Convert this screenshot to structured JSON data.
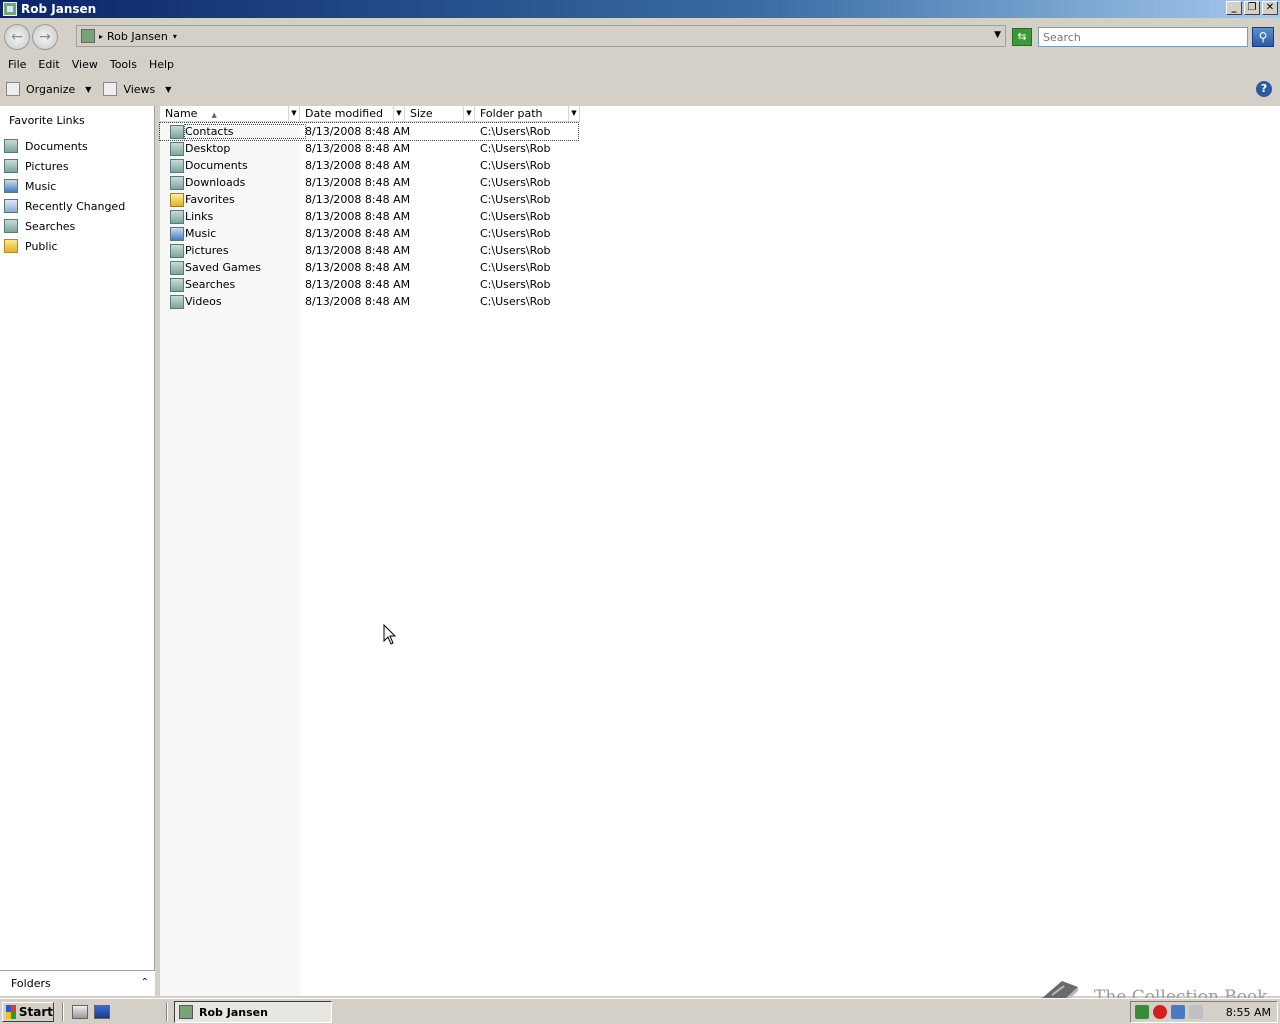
{
  "window": {
    "title": "Rob Jansen"
  },
  "address": {
    "crumb": "Rob Jansen",
    "search_placeholder": "Search"
  },
  "menu": [
    "File",
    "Edit",
    "View",
    "Tools",
    "Help"
  ],
  "toolbar": {
    "organize": "Organize",
    "views": "Views"
  },
  "navpane": {
    "title": "Favorite Links",
    "items": [
      {
        "label": "Documents",
        "icon": "documents-icon"
      },
      {
        "label": "Pictures",
        "icon": "pictures-icon"
      },
      {
        "label": "Music",
        "icon": "music-icon"
      },
      {
        "label": "Recently Changed",
        "icon": "recently-changed-icon"
      },
      {
        "label": "Searches",
        "icon": "searches-icon"
      },
      {
        "label": "Public",
        "icon": "folder-icon"
      }
    ],
    "folders_label": "Folders"
  },
  "columns": {
    "name": "Name",
    "date": "Date modified",
    "size": "Size",
    "path": "Folder path"
  },
  "files": [
    {
      "name": "Contacts",
      "date": "8/13/2008 8:48 AM",
      "path": "C:\\Users\\Rob"
    },
    {
      "name": "Desktop",
      "date": "8/13/2008 8:48 AM",
      "path": "C:\\Users\\Rob"
    },
    {
      "name": "Documents",
      "date": "8/13/2008 8:48 AM",
      "path": "C:\\Users\\Rob"
    },
    {
      "name": "Downloads",
      "date": "8/13/2008 8:48 AM",
      "path": "C:\\Users\\Rob"
    },
    {
      "name": "Favorites",
      "date": "8/13/2008 8:48 AM",
      "path": "C:\\Users\\Rob"
    },
    {
      "name": "Links",
      "date": "8/13/2008 8:48 AM",
      "path": "C:\\Users\\Rob"
    },
    {
      "name": "Music",
      "date": "8/13/2008 8:48 AM",
      "path": "C:\\Users\\Rob"
    },
    {
      "name": "Pictures",
      "date": "8/13/2008 8:48 AM",
      "path": "C:\\Users\\Rob"
    },
    {
      "name": "Saved Games",
      "date": "8/13/2008 8:48 AM",
      "path": "C:\\Users\\Rob"
    },
    {
      "name": "Searches",
      "date": "8/13/2008 8:48 AM",
      "path": "C:\\Users\\Rob"
    },
    {
      "name": "Videos",
      "date": "8/13/2008 8:48 AM",
      "path": "C:\\Users\\Rob"
    }
  ],
  "watermark": "The Collection Book",
  "taskbar": {
    "start": "Start",
    "task": "Rob Jansen",
    "clock": "8:55 AM"
  }
}
